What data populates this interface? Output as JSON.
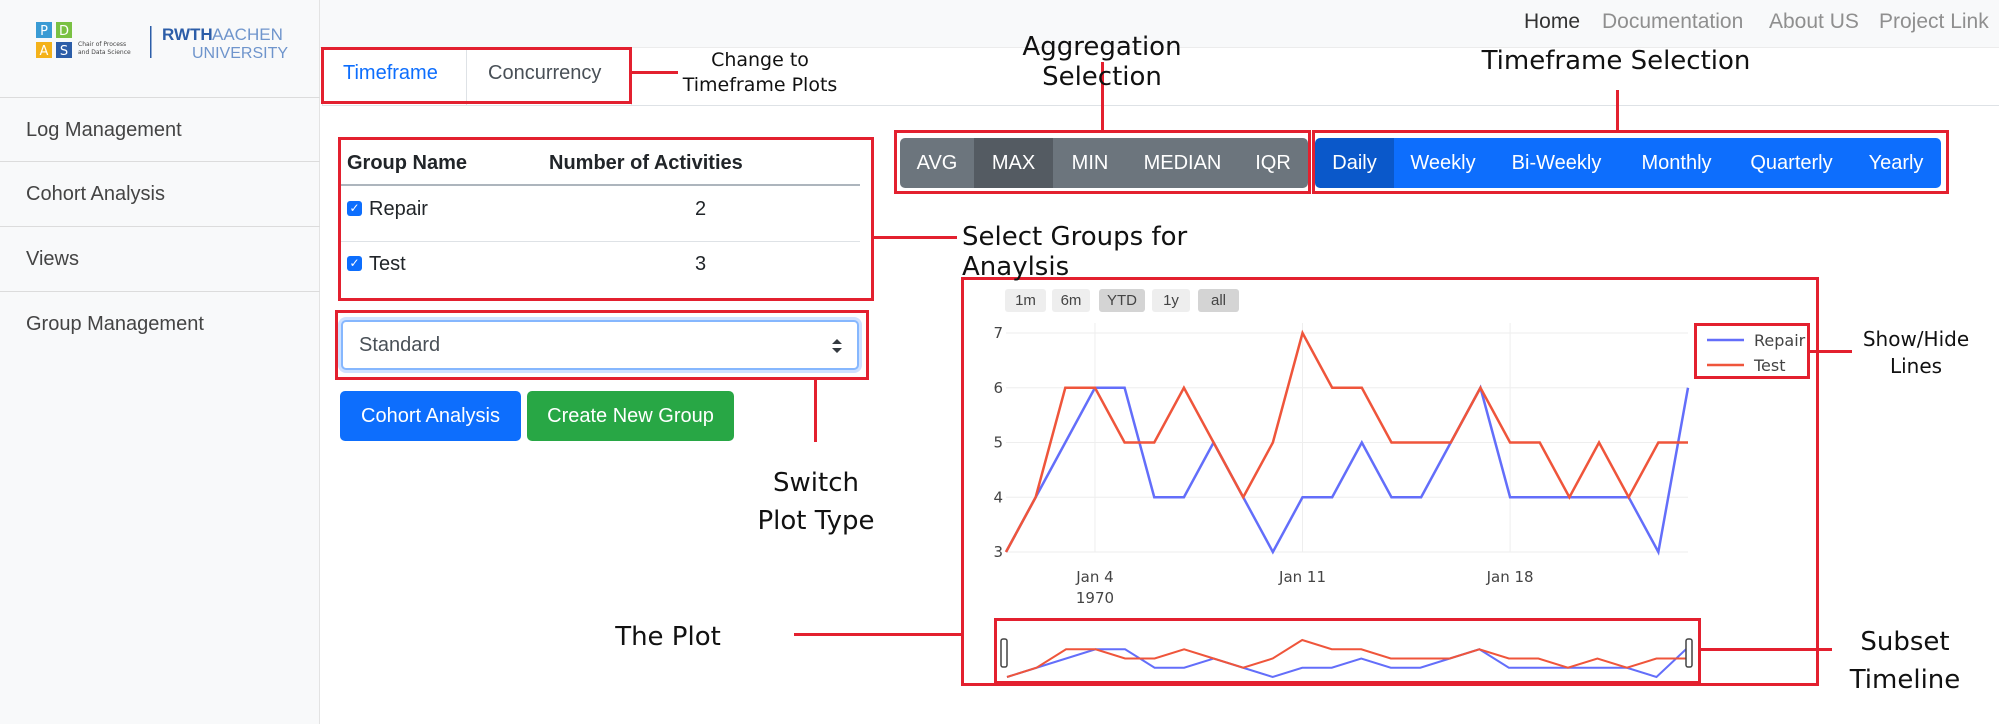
{
  "brand": {
    "pads_letters": [
      "P",
      "D",
      "A",
      "S"
    ],
    "pads_caption": [
      "Chair of Process",
      "and Data Science"
    ],
    "rwth_bold": "RWTH",
    "rwth_light": "AACHEN",
    "rwth_university": "UNIVERSITY"
  },
  "nav": {
    "home": "Home",
    "documentation": "Documentation",
    "about": "About US",
    "project": "Project Link"
  },
  "sidebar": {
    "items": [
      {
        "label": "Log Management"
      },
      {
        "label": "Cohort Analysis"
      },
      {
        "label": "Views"
      },
      {
        "label": "Group Management"
      }
    ]
  },
  "tabs": {
    "timeframe": "Timeframe",
    "concurrency": "Concurrency"
  },
  "table": {
    "headers": [
      "Group Name",
      "Number of Activities"
    ],
    "rows": [
      {
        "name": "Repair",
        "count": "2",
        "checked": true
      },
      {
        "name": "Test",
        "count": "3",
        "checked": true
      }
    ]
  },
  "select": {
    "value": "Standard"
  },
  "buttons": {
    "cohort": "Cohort Analysis",
    "create": "Create New Group"
  },
  "aggregation": {
    "options": [
      "AVG",
      "MAX",
      "MIN",
      "MEDIAN",
      "IQR"
    ],
    "selected": "MAX"
  },
  "timeframe": {
    "options": [
      "Daily",
      "Weekly",
      "Bi-Weekly",
      "Monthly",
      "Quarterly",
      "Yearly"
    ],
    "selected": "Daily"
  },
  "range_buttons": [
    "1m",
    "6m",
    "YTD",
    "1y",
    "all"
  ],
  "annotations": {
    "change_tf": [
      "Change to",
      "Timeframe Plots"
    ],
    "agg_sel": "Aggregation Selection",
    "tf_sel": "Timeframe Selection",
    "select_groups": "Select Groups for Anaylsis",
    "switch_plot": [
      "Switch",
      "Plot Type"
    ],
    "the_plot": "The Plot",
    "show_hide": [
      "Show/Hide",
      "Lines"
    ],
    "subset": [
      "Subset",
      "Timeline"
    ]
  },
  "colors": {
    "repair": "#636efa",
    "test": "#ef553b",
    "annotation": "#e3202f",
    "primary": "#0d6efd",
    "success": "#28a745",
    "secondary": "#6c757d"
  },
  "chart_data": {
    "type": "line",
    "x_start": "1970-01-01",
    "x_ticks": [
      "Jan 4\n1970",
      "Jan 11",
      "Jan 18"
    ],
    "y_ticks": [
      3,
      4,
      5,
      6,
      7
    ],
    "ylim": [
      3,
      7
    ],
    "series": [
      {
        "name": "Repair",
        "values": [
          3,
          4,
          5,
          6,
          6,
          4,
          4,
          5,
          4,
          3,
          4,
          4,
          5,
          4,
          4,
          5,
          6,
          4,
          4,
          4,
          4,
          4,
          3,
          6
        ]
      },
      {
        "name": "Test",
        "values": [
          3,
          4,
          6,
          6,
          5,
          5,
          6,
          5,
          4,
          5,
          7,
          6,
          6,
          5,
          5,
          5,
          6,
          5,
          5,
          4,
          5,
          4,
          5,
          5
        ]
      }
    ],
    "legend": "top-right"
  }
}
